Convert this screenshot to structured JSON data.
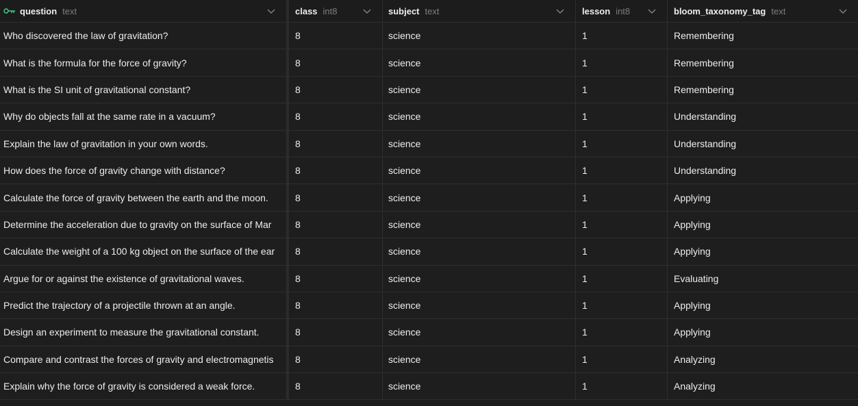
{
  "columns": [
    {
      "name": "question",
      "type": "text",
      "icon": "key-icon"
    },
    {
      "name": "class",
      "type": "int8"
    },
    {
      "name": "subject",
      "type": "text"
    },
    {
      "name": "lesson",
      "type": "int8"
    },
    {
      "name": "bloom_taxonomy_tag",
      "type": "text"
    }
  ],
  "rows": [
    {
      "question": "Who discovered the law of gravitation?",
      "class": "8",
      "subject": "science",
      "lesson": "1",
      "tag": "Remembering"
    },
    {
      "question": "What is the formula for the force of gravity?",
      "class": "8",
      "subject": "science",
      "lesson": "1",
      "tag": "Remembering"
    },
    {
      "question": "What is the SI unit of gravitational constant?",
      "class": "8",
      "subject": "science",
      "lesson": "1",
      "tag": "Remembering"
    },
    {
      "question": "Why do objects fall at the same rate in a vacuum?",
      "class": "8",
      "subject": "science",
      "lesson": "1",
      "tag": "Understanding"
    },
    {
      "question": "Explain the law of gravitation in your own words.",
      "class": "8",
      "subject": "science",
      "lesson": "1",
      "tag": "Understanding"
    },
    {
      "question": "How does the force of gravity change with distance?",
      "class": "8",
      "subject": "science",
      "lesson": "1",
      "tag": "Understanding"
    },
    {
      "question": "Calculate the force of gravity between the earth and the moon.",
      "class": "8",
      "subject": "science",
      "lesson": "1",
      "tag": "Applying"
    },
    {
      "question": "Determine the acceleration due to gravity on the surface of Mar",
      "class": "8",
      "subject": "science",
      "lesson": "1",
      "tag": "Applying"
    },
    {
      "question": "Calculate the weight of a 100 kg object on the surface of the ear",
      "class": "8",
      "subject": "science",
      "lesson": "1",
      "tag": "Applying"
    },
    {
      "question": "Argue for or against the existence of gravitational waves.",
      "class": "8",
      "subject": "science",
      "lesson": "1",
      "tag": "Evaluating"
    },
    {
      "question": "Predict the trajectory of a projectile thrown at an angle.",
      "class": "8",
      "subject": "science",
      "lesson": "1",
      "tag": "Applying"
    },
    {
      "question": "Design an experiment to measure the gravitational constant.",
      "class": "8",
      "subject": "science",
      "lesson": "1",
      "tag": "Applying"
    },
    {
      "question": "Compare and contrast the forces of gravity and electromagnetis",
      "class": "8",
      "subject": "science",
      "lesson": "1",
      "tag": "Analyzing"
    },
    {
      "question": "Explain why the force of gravity is considered a weak force.",
      "class": "8",
      "subject": "science",
      "lesson": "1",
      "tag": "Analyzing"
    }
  ],
  "colors": {
    "background": "#1c1c1c",
    "key_icon": "#3ecf8e",
    "border": "#2e2e2e"
  }
}
